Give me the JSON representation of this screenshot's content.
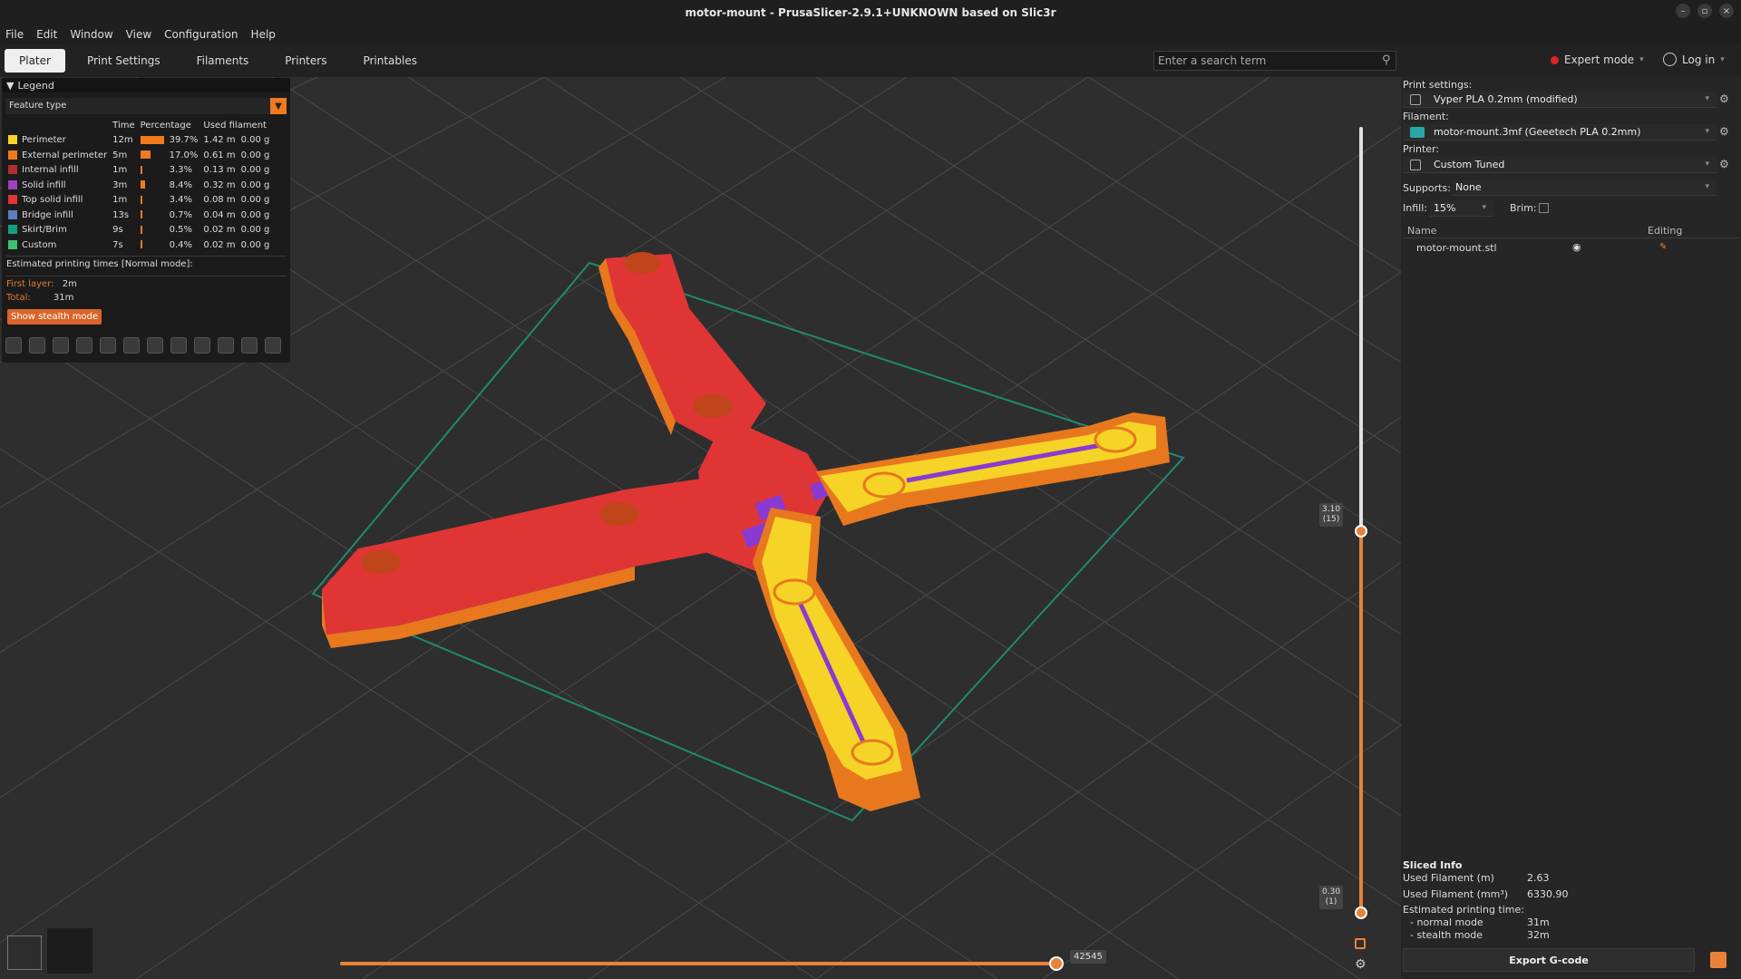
{
  "window": {
    "title": "motor-mount - PrusaSlicer-2.9.1+UNKNOWN based on Slic3r"
  },
  "menu": [
    "File",
    "Edit",
    "Window",
    "View",
    "Configuration",
    "Help"
  ],
  "tabs": [
    "Plater",
    "Print Settings",
    "Filaments",
    "Printers",
    "Printables"
  ],
  "search": {
    "placeholder": "Enter a search term"
  },
  "header": {
    "mode": "Expert mode",
    "login": "Log in"
  },
  "legend": {
    "title": "Legend",
    "view_type": "Feature type",
    "columns": [
      "Time",
      "Percentage",
      "Used filament"
    ],
    "rows": [
      {
        "name": "Perimeter",
        "time": "12m",
        "pct": "39.7%",
        "len": "1.42 m",
        "weight": "0.00 g",
        "color": "#f5d327",
        "frac": 0.397
      },
      {
        "name": "External perimeter",
        "time": "5m",
        "pct": "17.0%",
        "len": "0.61 m",
        "weight": "0.00 g",
        "color": "#f07a1e",
        "frac": 0.17
      },
      {
        "name": "Internal infill",
        "time": "1m",
        "pct": "3.3%",
        "len": "0.13 m",
        "weight": "0.00 g",
        "color": "#b03030",
        "frac": 0.033
      },
      {
        "name": "Solid infill",
        "time": "3m",
        "pct": "8.4%",
        "len": "0.32 m",
        "weight": "0.00 g",
        "color": "#a040c0",
        "frac": 0.084
      },
      {
        "name": "Top solid infill",
        "time": "1m",
        "pct": "3.4%",
        "len": "0.08 m",
        "weight": "0.00 g",
        "color": "#e03535",
        "frac": 0.034
      },
      {
        "name": "Bridge infill",
        "time": "13s",
        "pct": "0.7%",
        "len": "0.04 m",
        "weight": "0.00 g",
        "color": "#5b7ec0",
        "frac": 0.007
      },
      {
        "name": "Skirt/Brim",
        "time": "9s",
        "pct": "0.5%",
        "len": "0.02 m",
        "weight": "0.00 g",
        "color": "#10a080",
        "frac": 0.005
      },
      {
        "name": "Custom",
        "time": "7s",
        "pct": "0.4%",
        "len": "0.02 m",
        "weight": "0.00 g",
        "color": "#40c070",
        "frac": 0.004
      }
    ],
    "est_title": "Estimated printing times [Normal mode]:",
    "first_layer_label": "First layer:",
    "first_layer_value": "2m",
    "total_label": "Total:",
    "total_value": "31m",
    "stealth_button": "Show stealth mode"
  },
  "sliders": {
    "top_label": "3.10\n(15)",
    "bottom_label": "0.30\n(1)",
    "h_label": "42545"
  },
  "right": {
    "print_settings_label": "Print settings:",
    "print_settings_value": "Vyper PLA 0.2mm (modified)",
    "filament_label": "Filament:",
    "filament_value": "motor-mount.3mf (Geeetech PLA 0.2mm)",
    "filament_color": "#2aa6a6",
    "printer_label": "Printer:",
    "printer_value": "Custom Tuned",
    "supports_label": "Supports:",
    "supports_value": "None",
    "infill_label": "Infill:",
    "infill_value": "15%",
    "brim_label": "Brim:",
    "col_name": "Name",
    "col_editing": "Editing",
    "object_name": "motor-mount.stl"
  },
  "sliced": {
    "title": "Sliced Info",
    "used_m_label": "Used Filament (m)",
    "used_m_value": "2.63",
    "used_mm3_label": "Used Filament (mm³)",
    "used_mm3_value": "6330.90",
    "est_label": "Estimated printing time:",
    "normal_label": "- normal mode",
    "normal_value": "31m",
    "stealth_label": "- stealth mode",
    "stealth_value": "32m",
    "export": "Export G-code"
  }
}
